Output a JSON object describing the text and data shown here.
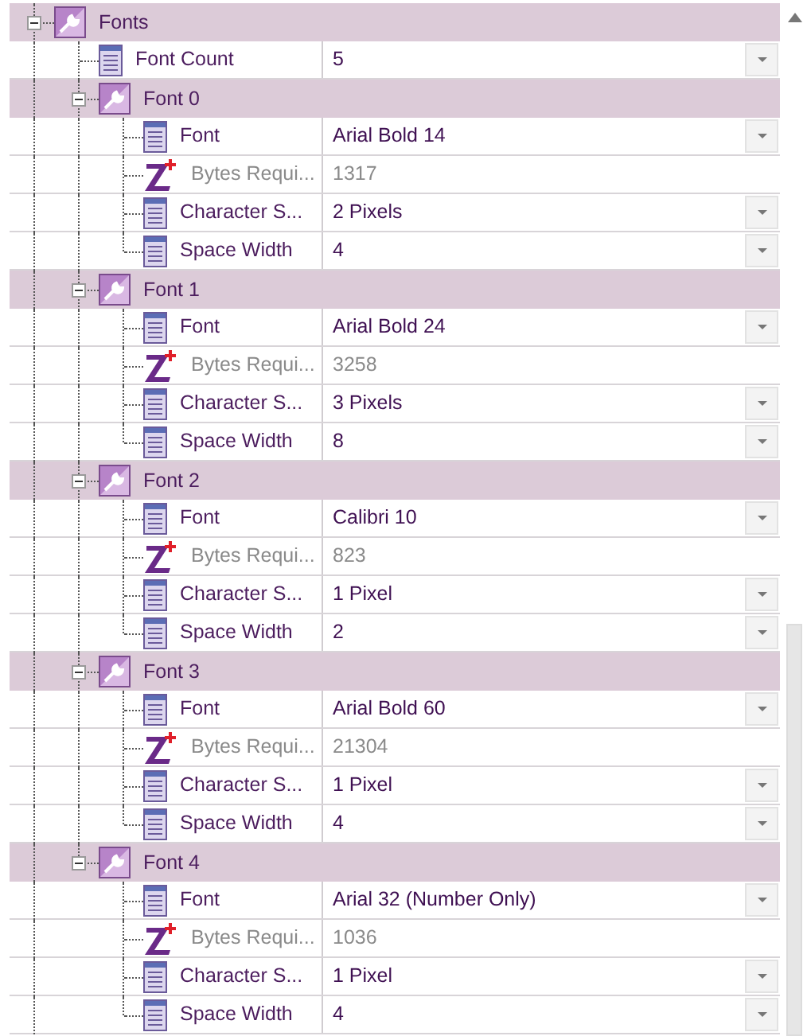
{
  "tree": [
    {
      "kind": "category",
      "label": "Fonts",
      "expanded": true,
      "children": [
        {
          "kind": "editable",
          "label": "Font Count",
          "value": "5",
          "dropdown": true
        },
        {
          "kind": "category",
          "label": "Font 0",
          "expanded": true,
          "children": [
            {
              "kind": "editable",
              "label": "Font",
              "value": "Arial Bold 14",
              "dropdown": true
            },
            {
              "kind": "readonly",
              "label": "Bytes Requi...",
              "value": "1317",
              "dropdown": false
            },
            {
              "kind": "editable",
              "label": "Character S...",
              "value": "2 Pixels",
              "dropdown": true
            },
            {
              "kind": "editable",
              "label": "Space Width",
              "value": "4",
              "dropdown": true
            }
          ]
        },
        {
          "kind": "category",
          "label": "Font 1",
          "expanded": true,
          "children": [
            {
              "kind": "editable",
              "label": "Font",
              "value": "Arial Bold 24",
              "dropdown": true
            },
            {
              "kind": "readonly",
              "label": "Bytes Requi...",
              "value": "3258",
              "dropdown": false
            },
            {
              "kind": "editable",
              "label": "Character S...",
              "value": "3 Pixels",
              "dropdown": true
            },
            {
              "kind": "editable",
              "label": "Space Width",
              "value": "8",
              "dropdown": true
            }
          ]
        },
        {
          "kind": "category",
          "label": "Font 2",
          "expanded": true,
          "children": [
            {
              "kind": "editable",
              "label": "Font",
              "value": "Calibri 10",
              "dropdown": true
            },
            {
              "kind": "readonly",
              "label": "Bytes Requi...",
              "value": "823",
              "dropdown": false
            },
            {
              "kind": "editable",
              "label": "Character S...",
              "value": "1 Pixel",
              "dropdown": true
            },
            {
              "kind": "editable",
              "label": "Space Width",
              "value": "2",
              "dropdown": true
            }
          ]
        },
        {
          "kind": "category",
          "label": "Font 3",
          "expanded": true,
          "children": [
            {
              "kind": "editable",
              "label": "Font",
              "value": "Arial Bold 60",
              "dropdown": true
            },
            {
              "kind": "readonly",
              "label": "Bytes Requi...",
              "value": "21304",
              "dropdown": false
            },
            {
              "kind": "editable",
              "label": "Character S...",
              "value": "1 Pixel",
              "dropdown": true
            },
            {
              "kind": "editable",
              "label": "Space Width",
              "value": "4",
              "dropdown": true
            }
          ]
        },
        {
          "kind": "category",
          "label": "Font 4",
          "expanded": true,
          "children": [
            {
              "kind": "editable",
              "label": "Font",
              "value": "Arial 32 (Number Only)",
              "dropdown": true
            },
            {
              "kind": "readonly",
              "label": "Bytes Requi...",
              "value": "1036",
              "dropdown": false
            },
            {
              "kind": "editable",
              "label": "Character S...",
              "value": "1 Pixel",
              "dropdown": true
            },
            {
              "kind": "editable",
              "label": "Space Width",
              "value": "4",
              "dropdown": true
            }
          ]
        }
      ]
    }
  ]
}
